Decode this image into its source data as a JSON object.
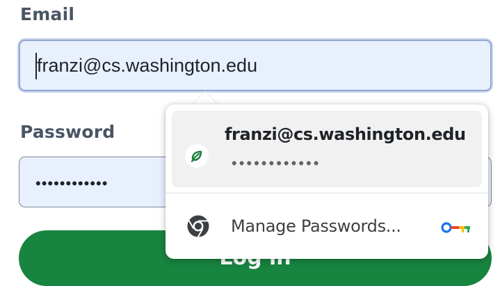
{
  "form": {
    "email_label": "Email",
    "email_value": "franzi@cs.washington.edu",
    "password_label": "Password",
    "password_value": "••••••••••••",
    "login_button": "Log in"
  },
  "autofill_popup": {
    "credential": {
      "username": "franzi@cs.washington.edu",
      "password_mask": "••••••••••••",
      "site_icon": "leaf-icon"
    },
    "manage_label": "Manage Passwords...",
    "manage_icon": "chrome-icon",
    "key_icon": "key-icon"
  },
  "colors": {
    "field_bg": "#e8f0fe",
    "button_green": "#17843f",
    "popup_row_bg": "#f1f1f1"
  }
}
